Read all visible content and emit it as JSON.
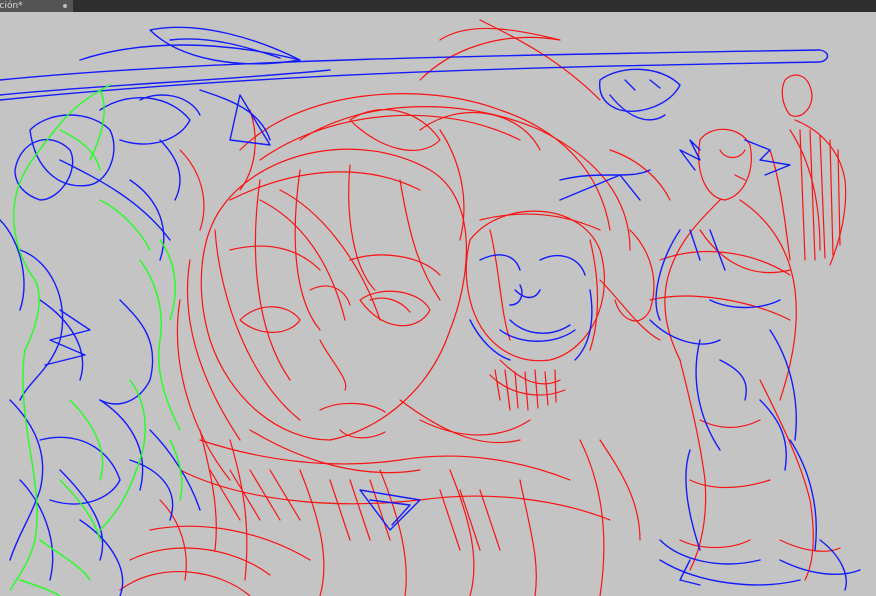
{
  "document_tab": {
    "label": "ación*",
    "close_icon": "close-dot-icon"
  },
  "canvas": {
    "background": "#c4c4c4",
    "stroke_colors": {
      "red": "#ff0000",
      "blue": "#0a14ff",
      "green": "#22ff22"
    }
  }
}
